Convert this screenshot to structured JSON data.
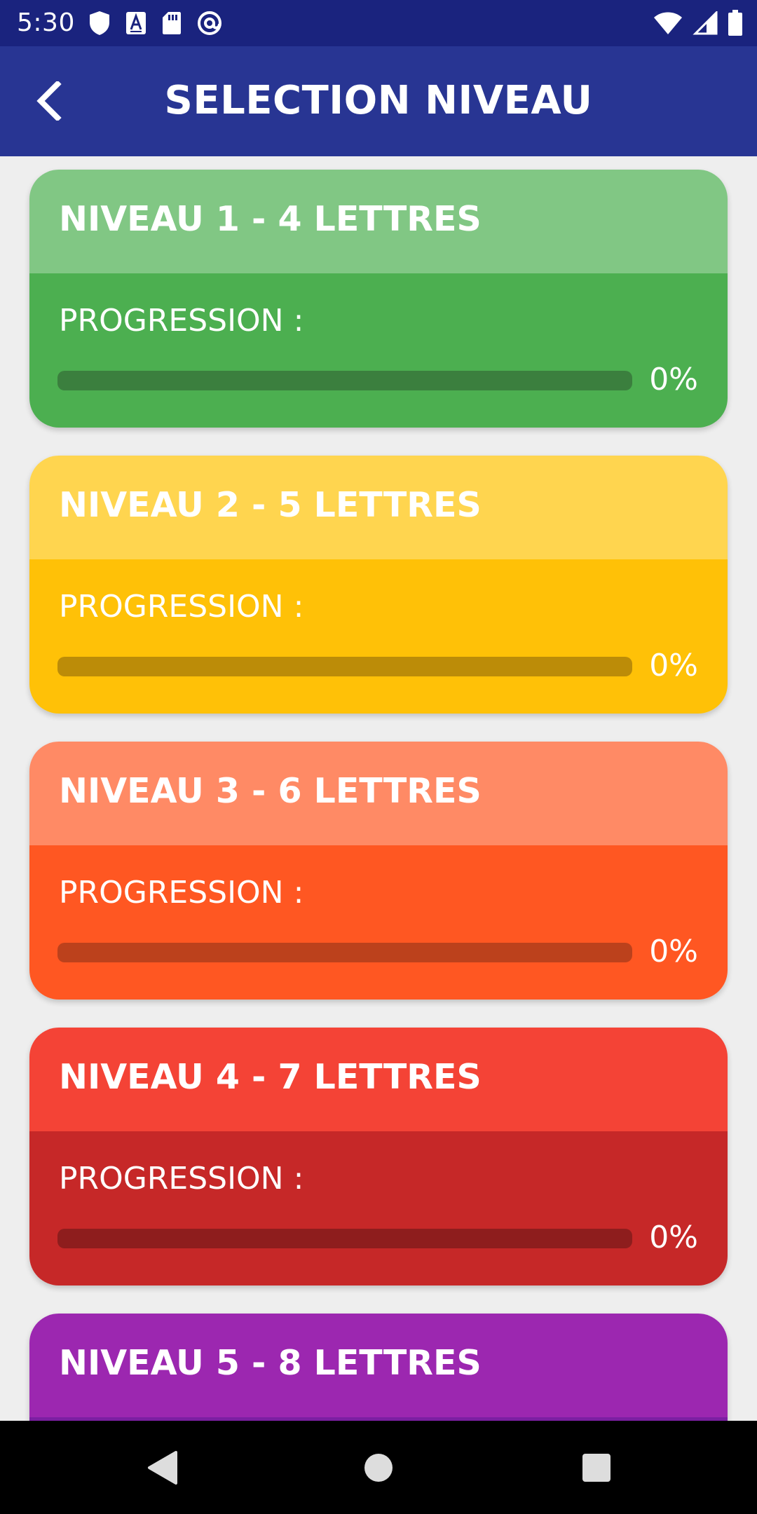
{
  "status_bar": {
    "time": "5:30",
    "left_icons": [
      "shield-icon",
      "font-a-icon",
      "sd-card-icon",
      "at-sign-icon"
    ],
    "right_icons": [
      "wifi-icon",
      "cellular-signal-icon",
      "battery-icon"
    ]
  },
  "app_bar": {
    "back_icon": "chevron-left-icon",
    "title": "SELECTION NIVEAU"
  },
  "levels": [
    {
      "title": "NIVEAU 1 - 4 LETTRES",
      "progress_label": "PROGRESSION :",
      "progress_value": "0%",
      "progress_fraction": 0,
      "header_color": "#81C784",
      "body_color": "#4CAF50",
      "track_color": "#3B7F3E"
    },
    {
      "title": "NIVEAU 2 - 5 LETTRES",
      "progress_label": "PROGRESSION :",
      "progress_value": "0%",
      "progress_fraction": 0,
      "header_color": "#FFD54F",
      "body_color": "#FFC107",
      "track_color": "#BC8C08"
    },
    {
      "title": "NIVEAU 3 - 6 LETTRES",
      "progress_label": "PROGRESSION :",
      "progress_value": "0%",
      "progress_fraction": 0,
      "header_color": "#FF8A65",
      "body_color": "#FF5722",
      "track_color": "#BC411C"
    },
    {
      "title": "NIVEAU 4 - 7 LETTRES",
      "progress_label": "PROGRESSION :",
      "progress_value": "0%",
      "progress_fraction": 0,
      "header_color": "#F44336",
      "body_color": "#C62828",
      "track_color": "#8E1D1D"
    },
    {
      "title": "NIVEAU 5 - 8 LETTRES",
      "header_color": "#9C27B0",
      "body_color": "#7B1FA2"
    }
  ],
  "nav_bar": {
    "icons": [
      "back-triangle-icon",
      "home-circle-icon",
      "recents-square-icon"
    ]
  }
}
